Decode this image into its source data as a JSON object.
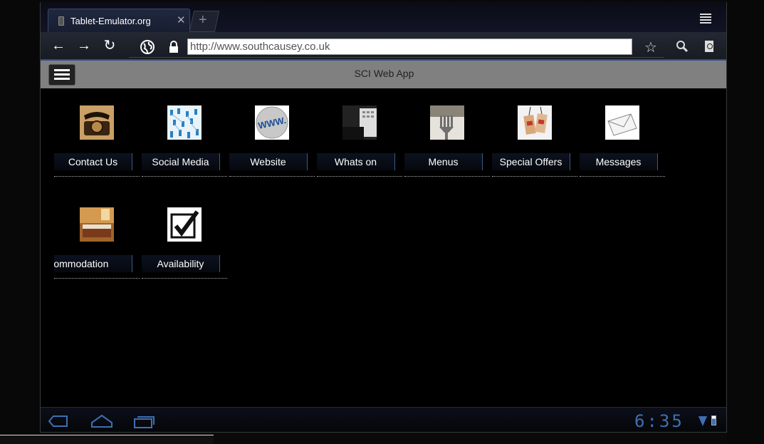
{
  "browser": {
    "tab_title": "Tablet-Emulator.org",
    "url": "http://www.southcausey.co.uk"
  },
  "app": {
    "title": "SCI Web App"
  },
  "tiles": [
    {
      "label": "Contact Us",
      "icon": "rotary-phone-image"
    },
    {
      "label": "Social Media",
      "icon": "social-network-image"
    },
    {
      "label": "Website",
      "icon": "www-globe-image"
    },
    {
      "label": "Whats on",
      "icon": "calendar-image"
    },
    {
      "label": "Menus",
      "icon": "fork-image"
    },
    {
      "label": "Special Offers",
      "icon": "price-tags-image"
    },
    {
      "label": "Messages",
      "icon": "envelope-image"
    },
    {
      "label": "Accommodation",
      "icon": "hotel-room-image"
    },
    {
      "label": "Availability",
      "icon": "checkmark-image"
    }
  ],
  "system": {
    "clock": "6:35"
  },
  "colors": {
    "accent": "#3f6fb0",
    "header_gray": "#808080"
  }
}
